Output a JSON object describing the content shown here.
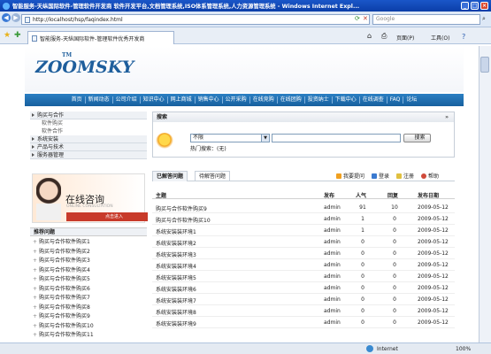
{
  "window": {
    "title": "智能服务-天纵国际软件-管理软件开发商 软件开发平台,文档管理系统,ISO体系管理系统,人力资源管理系统 - Windows Internet Expl...",
    "address": "http://localhost/hsp/faqindex.html",
    "search_placeholder": "Google",
    "tab_title": "智能服务-天纵国际软件-管理软件优秀开发商",
    "page_menu": "页面(P)",
    "tools_menu": "工具(O)",
    "status": "Internet",
    "zoom": "100%"
  },
  "site": {
    "logo": "ZOOMSKY",
    "logo_tm": "TM",
    "nav": [
      "首页",
      "新闻动态",
      "公司介绍",
      "知识中心",
      "网上商城",
      "销售中心",
      "公开采购",
      "在线竞购",
      "在线团购",
      "投资纳士",
      "下载中心",
      "在线调查",
      "FAQ",
      "论坛"
    ]
  },
  "sidebar": {
    "menu": [
      {
        "label": "购买与合作",
        "level": "top"
      },
      {
        "label": "软件购买",
        "level": "sub"
      },
      {
        "label": "软件合作",
        "level": "sub"
      },
      {
        "label": "系统安装",
        "level": "top"
      },
      {
        "label": "产品与技术",
        "level": "top"
      },
      {
        "label": "服务器管理",
        "level": "top"
      }
    ],
    "consult_title": "在线咨询",
    "consult_en": "ONLINE CONSULTATION",
    "consult_go": "点击进入",
    "recommended_title": "推荐问题",
    "recommended": [
      "购买与合作软件购买1",
      "购买与合作软件购买2",
      "购买与合作软件购买3",
      "购买与合作软件购买4",
      "购买与合作软件购买5",
      "购买与合作软件购买6",
      "购买与合作软件购买7",
      "购买与合作软件购买8",
      "购买与合作软件购买9",
      "购买与合作软件购买10",
      "购买与合作软件购买11"
    ]
  },
  "search": {
    "title": "搜索",
    "category": "不限",
    "button": "搜索",
    "hot": "热门搜索：(无)"
  },
  "tabs": {
    "answered": "已解答问题",
    "pending": "待解答问题"
  },
  "actions": {
    "ask": "我要提问",
    "login": "登录",
    "register": "注册",
    "help": "帮助"
  },
  "table": {
    "headers": [
      "主题",
      "发布",
      "人气",
      "回复",
      "发布日期"
    ],
    "rows": [
      [
        "购买与合作软件购买9",
        "admin",
        "91",
        "10",
        "2009-05-12"
      ],
      [
        "购买与合作软件购买10",
        "admin",
        "1",
        "0",
        "2009-05-12"
      ],
      [
        "系统安装装环境1",
        "admin",
        "1",
        "0",
        "2009-05-12"
      ],
      [
        "系统安装装环境2",
        "admin",
        "0",
        "0",
        "2009-05-12"
      ],
      [
        "系统安装装环境3",
        "admin",
        "0",
        "0",
        "2009-05-12"
      ],
      [
        "系统安装装环境4",
        "admin",
        "0",
        "0",
        "2009-05-12"
      ],
      [
        "系统安装装环境5",
        "admin",
        "0",
        "0",
        "2009-05-12"
      ],
      [
        "系统安装装环境6",
        "admin",
        "0",
        "0",
        "2009-05-12"
      ],
      [
        "系统安装装环境7",
        "admin",
        "0",
        "0",
        "2009-05-12"
      ],
      [
        "系统安装装环境8",
        "admin",
        "0",
        "0",
        "2009-05-12"
      ],
      [
        "系统安装装环境9",
        "admin",
        "0",
        "0",
        "2009-05-12"
      ]
    ]
  }
}
